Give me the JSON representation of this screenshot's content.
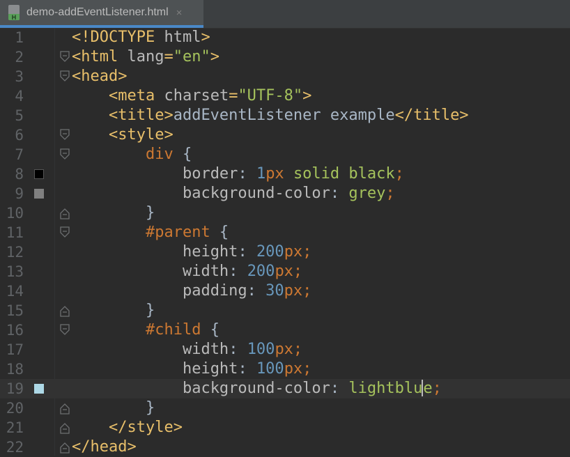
{
  "tab": {
    "title": "demo-addEventListener.html",
    "close_glyph": "×",
    "icon": "html-file-icon",
    "icon_letter": "H"
  },
  "colors": {
    "tag": "#e8bf6a",
    "attr": "#bababa",
    "string": "#a5c25c",
    "text": "#a9b7c6",
    "prop": "#bababa",
    "number": "#6897bb",
    "value": "#a5c25c",
    "punct": "#cc7832",
    "selector": "#cc7832",
    "accent": "#4a88c7"
  },
  "lines": [
    {
      "n": "1",
      "tokens": [
        [
          "tag",
          "<!DOCTYPE "
        ],
        [
          "attr",
          "html"
        ],
        [
          "tag",
          ">"
        ]
      ]
    },
    {
      "n": "2",
      "fold": "start",
      "tokens": [
        [
          "tag",
          "<html "
        ],
        [
          "attr",
          "lang"
        ],
        [
          "tag",
          "="
        ],
        [
          "string",
          "\"en\""
        ],
        [
          "tag",
          ">"
        ]
      ]
    },
    {
      "n": "3",
      "fold": "start",
      "tokens": [
        [
          "tag",
          "<head>"
        ]
      ]
    },
    {
      "n": "4",
      "tokens": [
        [
          "text",
          "    "
        ],
        [
          "tag",
          "<meta "
        ],
        [
          "attr",
          "charset"
        ],
        [
          "tag",
          "="
        ],
        [
          "string",
          "\"UTF-8\""
        ],
        [
          "tag",
          ">"
        ]
      ]
    },
    {
      "n": "5",
      "tokens": [
        [
          "text",
          "    "
        ],
        [
          "tag",
          "<title>"
        ],
        [
          "text",
          "addEventListener example"
        ],
        [
          "tag",
          "</title>"
        ]
      ]
    },
    {
      "n": "6",
      "fold": "start",
      "tokens": [
        [
          "text",
          "    "
        ],
        [
          "tag",
          "<style>"
        ]
      ]
    },
    {
      "n": "7",
      "fold": "start",
      "tokens": [
        [
          "text",
          "        "
        ],
        [
          "selector",
          "div"
        ],
        [
          "text",
          " {"
        ]
      ]
    },
    {
      "n": "8",
      "swatch": "#000000",
      "tokens": [
        [
          "text",
          "            "
        ],
        [
          "prop",
          "border"
        ],
        [
          "text",
          ": "
        ],
        [
          "number",
          "1"
        ],
        [
          "punct",
          "px"
        ],
        [
          "text",
          " "
        ],
        [
          "value",
          "solid black"
        ],
        [
          "punct",
          ";"
        ]
      ]
    },
    {
      "n": "9",
      "swatch": "#808080",
      "tokens": [
        [
          "text",
          "            "
        ],
        [
          "prop",
          "background-color"
        ],
        [
          "text",
          ": "
        ],
        [
          "value",
          "grey"
        ],
        [
          "punct",
          ";"
        ]
      ]
    },
    {
      "n": "10",
      "fold": "end",
      "tokens": [
        [
          "text",
          "        }"
        ]
      ]
    },
    {
      "n": "11",
      "fold": "start",
      "tokens": [
        [
          "text",
          "        "
        ],
        [
          "selector",
          "#parent"
        ],
        [
          "text",
          " {"
        ]
      ]
    },
    {
      "n": "12",
      "tokens": [
        [
          "text",
          "            "
        ],
        [
          "prop",
          "height"
        ],
        [
          "text",
          ": "
        ],
        [
          "number",
          "200"
        ],
        [
          "punct",
          "px;"
        ]
      ]
    },
    {
      "n": "13",
      "tokens": [
        [
          "text",
          "            "
        ],
        [
          "prop",
          "width"
        ],
        [
          "text",
          ": "
        ],
        [
          "number",
          "200"
        ],
        [
          "punct",
          "px;"
        ]
      ]
    },
    {
      "n": "14",
      "tokens": [
        [
          "text",
          "            "
        ],
        [
          "prop",
          "padding"
        ],
        [
          "text",
          ": "
        ],
        [
          "number",
          "30"
        ],
        [
          "punct",
          "px;"
        ]
      ]
    },
    {
      "n": "15",
      "fold": "end",
      "tokens": [
        [
          "text",
          "        }"
        ]
      ]
    },
    {
      "n": "16",
      "fold": "start",
      "tokens": [
        [
          "text",
          "        "
        ],
        [
          "selector",
          "#child"
        ],
        [
          "text",
          " {"
        ]
      ]
    },
    {
      "n": "17",
      "tokens": [
        [
          "text",
          "            "
        ],
        [
          "prop",
          "width"
        ],
        [
          "text",
          ": "
        ],
        [
          "number",
          "100"
        ],
        [
          "punct",
          "px;"
        ]
      ]
    },
    {
      "n": "18",
      "tokens": [
        [
          "text",
          "            "
        ],
        [
          "prop",
          "height"
        ],
        [
          "text",
          ": "
        ],
        [
          "number",
          "100"
        ],
        [
          "punct",
          "px;"
        ]
      ]
    },
    {
      "n": "19",
      "current": true,
      "swatch": "#add8e6",
      "caret_after": 8,
      "tokens": [
        [
          "text",
          "            "
        ],
        [
          "prop",
          "background-color"
        ],
        [
          "text",
          ": "
        ],
        [
          "value",
          "lightblue"
        ],
        [
          "punct",
          ";"
        ]
      ]
    },
    {
      "n": "20",
      "fold": "end",
      "tokens": [
        [
          "text",
          "        }"
        ]
      ]
    },
    {
      "n": "21",
      "fold": "end",
      "tokens": [
        [
          "text",
          "    "
        ],
        [
          "tag",
          "</style>"
        ]
      ]
    },
    {
      "n": "22",
      "fold": "end",
      "tokens": [
        [
          "tag",
          "</head>"
        ]
      ]
    }
  ]
}
